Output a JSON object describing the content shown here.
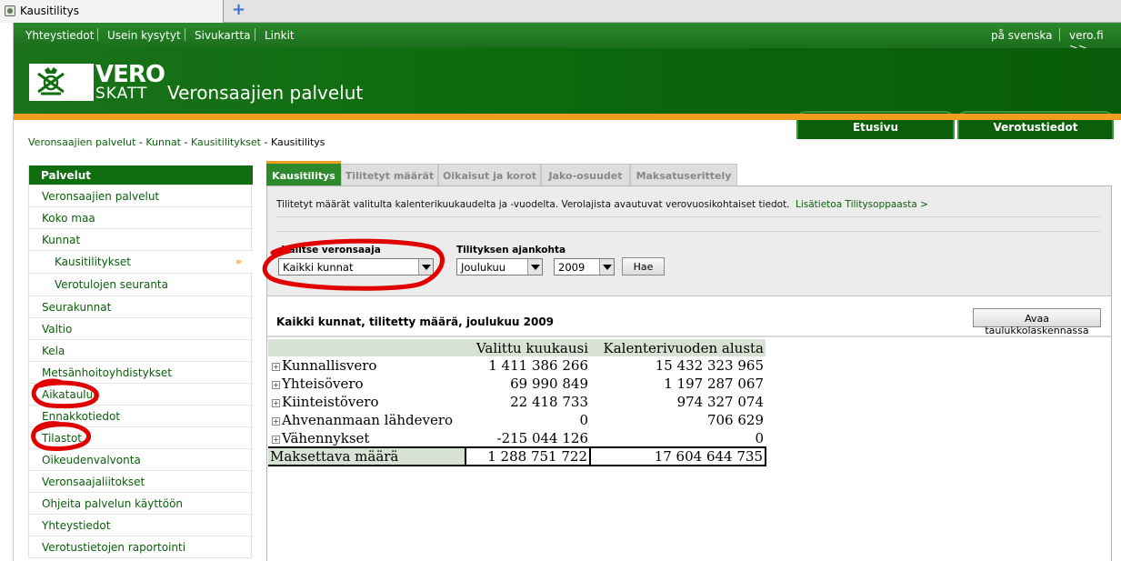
{
  "browser": {
    "tab_title": "Kausitilitys",
    "new_tab_symbol": "+"
  },
  "topnav": {
    "links": [
      "Yhteystiedot",
      "Usein kysytyt",
      "Sivukartta",
      "Linkit"
    ],
    "right_links": [
      "på svenska",
      "vero.fi >>"
    ]
  },
  "header": {
    "logo_top": "VERO",
    "logo_bottom": "SKATT",
    "site_title": "Veronsaajien palvelut",
    "tabs": [
      "Etusivu",
      "Verotustiedot"
    ]
  },
  "breadcrumb": {
    "items": [
      "Veronsaajien palvelut",
      "Kunnat",
      "Kausitilitykset"
    ],
    "separator": " - ",
    "current": "Kausitilitys"
  },
  "sidebar": {
    "heading": "Palvelut",
    "items": [
      {
        "label": "Veronsaajien palvelut"
      },
      {
        "label": "Koko maa"
      },
      {
        "label": "Kunnat"
      },
      {
        "label": "Kausitilitykset",
        "arrow": "»"
      },
      {
        "label": "Verotulojen seuranta"
      },
      {
        "label": "Seurakunnat"
      },
      {
        "label": "Valtio"
      },
      {
        "label": "Kela"
      },
      {
        "label": "Metsänhoitoyhdistykset"
      },
      {
        "label": "Aikataulut"
      },
      {
        "label": "Ennakkotiedot"
      },
      {
        "label": "Tilastot"
      },
      {
        "label": "Oikeudenvalvonta"
      },
      {
        "label": "Veronsaajaliitokset"
      },
      {
        "label": "Ohjeita palvelun käyttöön"
      },
      {
        "label": "Yhteystiedot"
      },
      {
        "label": "Verotustietojen raportointi"
      }
    ]
  },
  "content": {
    "tabs": [
      "Kausitilitys",
      "Tilitetyt määrät",
      "Oikaisut ja korot",
      "Jako-osuudet",
      "Maksatuserittely"
    ],
    "intro": "Tilitetyt määrät valitulta kalenterikuukaudelta ja -vuodelta. Verolajista avautuvat verovuosikohtaiset tiedot.",
    "more_link": "Lisätietoa Tilitysoppaasta >",
    "recipient_label": "Valitse veronsaaja",
    "recipient_value": "Kaikki kunnat",
    "date_label": "Tilityksen ajankohta",
    "month_value": "Joulukuu",
    "year_value": "2009",
    "search_button": "Hae",
    "result_title": "Kaikki kunnat, tilitetty määrä, joulukuu 2009",
    "spreadsheet_button": "Avaa taulukkolaskennassa",
    "table": {
      "headers": [
        "",
        "Valittu kuukausi",
        "Kalenterivuoden alusta"
      ],
      "rows": [
        {
          "name": "Kunnallisvero",
          "month": "1 411 386 266",
          "ytd": "15 432 323 965"
        },
        {
          "name": "Yhteisövero",
          "month": "69 990 849",
          "ytd": "1 197 287 067"
        },
        {
          "name": "Kiinteistövero",
          "month": "22 418 733",
          "ytd": "974 327 074"
        },
        {
          "name": "Ahvenanmaan lähdevero",
          "month": "0",
          "ytd": "706 629"
        },
        {
          "name": "Vähennykset",
          "month": "-215 044 126",
          "ytd": "0"
        }
      ],
      "total": {
        "name": "Maksettava määrä",
        "month": "1 288 751 722",
        "ytd": "17 604 644 735"
      }
    }
  },
  "colors": {
    "brand_green": "#106d10",
    "accent_orange": "#f29d1f",
    "annotation_red": "#e00000"
  }
}
